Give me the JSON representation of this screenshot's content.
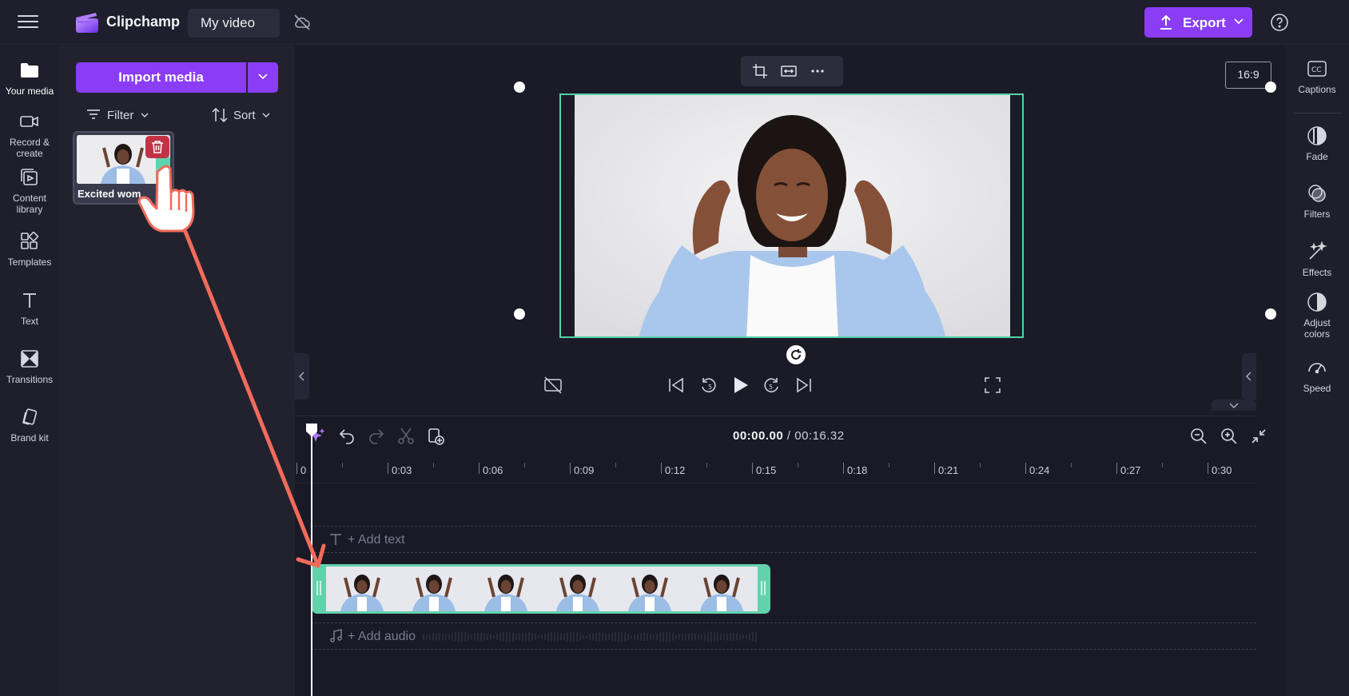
{
  "header": {
    "app_name": "Clipchamp",
    "project_name": "My video",
    "export_label": "Export"
  },
  "left_nav": {
    "items": [
      {
        "label": "Your media",
        "icon": "folder-icon",
        "active": true
      },
      {
        "label": "Record &\ncreate",
        "icon": "camera-icon"
      },
      {
        "label": "Content\nlibrary",
        "icon": "library-icon"
      },
      {
        "label": "Templates",
        "icon": "templates-icon"
      },
      {
        "label": "Text",
        "icon": "text-icon"
      },
      {
        "label": "Transitions",
        "icon": "transitions-icon"
      },
      {
        "label": "Brand kit",
        "icon": "brand-kit-icon"
      }
    ]
  },
  "media_panel": {
    "import_label": "Import media",
    "filter_label": "Filter",
    "sort_label": "Sort",
    "items": [
      {
        "name": "Excited wom"
      }
    ]
  },
  "preview": {
    "aspect_ratio": "16:9"
  },
  "timeline": {
    "current_time": "00:00.00",
    "duration": "/ 00:16.32",
    "ticks": [
      "0",
      "0:03",
      "0:06",
      "0:09",
      "0:12",
      "0:15",
      "0:18",
      "0:21",
      "0:24",
      "0:27",
      "0:30"
    ],
    "add_text_label": "+ Add text",
    "add_audio_label": "+ Add audio"
  },
  "right_panel": {
    "items": [
      {
        "label": "Captions",
        "icon": "captions-icon"
      },
      {
        "label": "Fade",
        "icon": "fade-icon"
      },
      {
        "label": "Filters",
        "icon": "filters-icon"
      },
      {
        "label": "Effects",
        "icon": "effects-icon"
      },
      {
        "label": "Adjust\ncolors",
        "icon": "adjust-colors-icon"
      },
      {
        "label": "Speed",
        "icon": "speed-icon"
      }
    ]
  },
  "colors": {
    "accent": "#8a3df5",
    "selection": "#55d1a8",
    "delete": "#c43245",
    "annotation": "#f26b5b"
  }
}
